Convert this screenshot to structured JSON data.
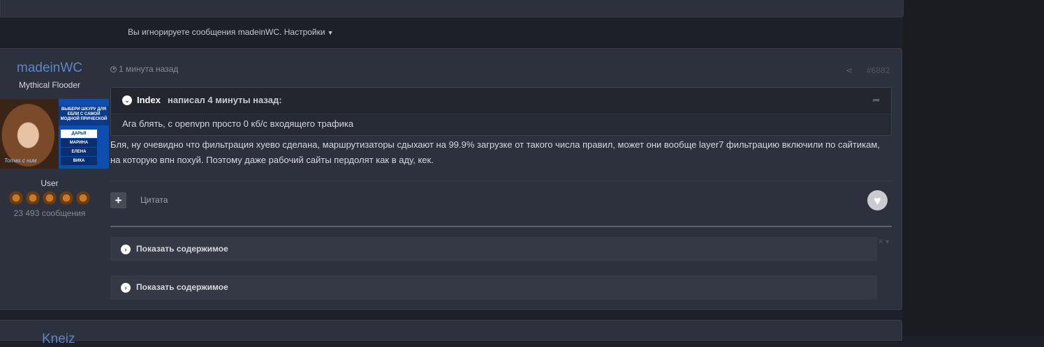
{
  "ignored_bar": {
    "text": "Вы игнорируете сообщения madeinWC.",
    "settings_label": "Настройки"
  },
  "post": {
    "author": {
      "name": "madeinWC",
      "title": "Mythical Flooder",
      "group": "User",
      "post_count": "23 493 сообщения",
      "avatar": {
        "headline": "ВЫБЕРИ ШКУРУ ДЛЯ ЕБЛИ С САМОЙ МОДНОЙ ПРИЧЕСКОЙ",
        "menu": [
          "ДАРЬЯ",
          "МАРИНА",
          "ЕЛЕНА",
          "ВИКА"
        ],
        "signature": "Tomas с ним"
      }
    },
    "time": "1 минута назад",
    "number": "#6882",
    "quote": {
      "author": "Index",
      "wrote": "написал 4 минуты назад:",
      "text": "Ага блять, с openvpn просто 0 кб/с входящего трафика"
    },
    "body": "Бля, ну очевидно что фильтрация хуево сделана, маршрутизаторы сдыхают на 99.9% загрузке от такого числа правил, может они вообще layer7 фильтрацию включили по сайтикам, на которую впн похуй. Поэтому даже рабочий сайты пердолят как в аду, кек.",
    "quote_button": "Цитата",
    "spoilers": [
      {
        "label": "Показать содержимое"
      },
      {
        "label": "Показать содержимое"
      }
    ]
  },
  "next_post": {
    "author_name": "Kneiz"
  },
  "colors": {
    "author_link": "#5d86c9",
    "card_bg": "#2d313d",
    "page_bg": "#1d2029"
  },
  "icons": [
    "clock-icon",
    "share-icon",
    "chevron-down-icon",
    "reply-arrow-icon",
    "plus-icon",
    "heart-icon",
    "chevron-right-icon",
    "close-icon",
    "caret-down-icon"
  ]
}
